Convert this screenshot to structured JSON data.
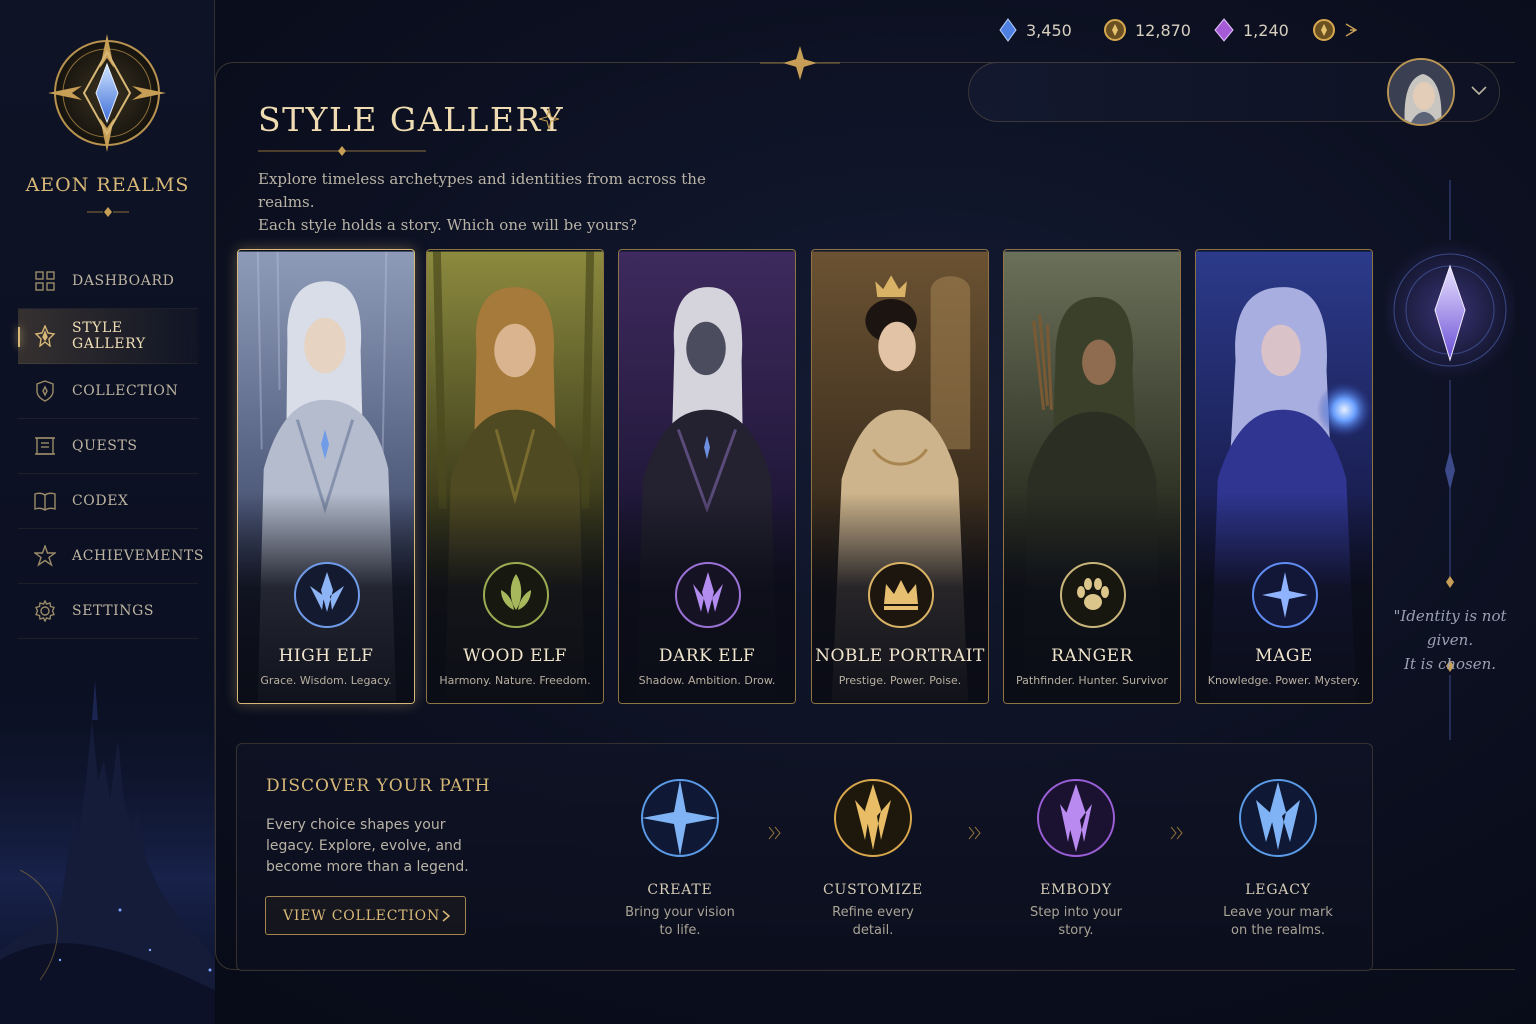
{
  "app": {
    "brand": "AEON REALMS"
  },
  "sidebar": {
    "items": [
      {
        "label": "DASHBOARD",
        "icon": "grid-icon",
        "active": false
      },
      {
        "label": "STYLE GALLERY",
        "icon": "flame-crest-icon",
        "active": true
      },
      {
        "label": "COLLECTION",
        "icon": "shield-icon",
        "active": false
      },
      {
        "label": "QUESTS",
        "icon": "scroll-icon",
        "active": false
      },
      {
        "label": "CODEX",
        "icon": "book-icon",
        "active": false
      },
      {
        "label": "ACHIEVEMENTS",
        "icon": "star-icon",
        "active": false
      },
      {
        "label": "SETTINGS",
        "icon": "gear-icon",
        "active": false
      }
    ]
  },
  "header": {
    "title": "STYLE GALLERY",
    "subtitle_line1": "Explore timeless archetypes and identities from across the realms.",
    "subtitle_line2": "Each style holds a story. Which one will be yours?"
  },
  "currencies": [
    {
      "value": "3,450",
      "icon": "blue-crystal-icon",
      "color": "#4f7fe0"
    },
    {
      "value": "12,870",
      "icon": "gold-coin-icon",
      "color": "#d6a84f"
    },
    {
      "value": "1,240",
      "icon": "purple-gem-icon",
      "color": "#a65bd6"
    }
  ],
  "styles": [
    {
      "name": "HIGH ELF",
      "tagline": "Grace. Wisdom. Legacy.",
      "accent": "#6f9be8",
      "selected": true
    },
    {
      "name": "WOOD ELF",
      "tagline": "Harmony. Nature. Freedom.",
      "accent": "#9cab52",
      "selected": false
    },
    {
      "name": "DARK ELF",
      "tagline": "Shadow. Ambition. Drow.",
      "accent": "#9a72d6",
      "selected": false
    },
    {
      "name": "NOBLE PORTRAIT",
      "tagline": "Prestige. Power. Poise.",
      "accent": "#d9b266",
      "selected": false
    },
    {
      "name": "RANGER",
      "tagline": "Pathfinder. Hunter. Survivor",
      "accent": "#c9b57a",
      "selected": false
    },
    {
      "name": "MAGE",
      "tagline": "Knowledge. Power. Mystery.",
      "accent": "#5f8cf0",
      "selected": false
    }
  ],
  "quote": {
    "line1": "\"Identity is not",
    "line2": "given.",
    "line3": "It is chosen."
  },
  "discover": {
    "title": "DISCOVER YOUR PATH",
    "text": "Every choice shapes your legacy. Explore, evolve, and become more than a legend.",
    "button": "VIEW COLLECTION",
    "steps": [
      {
        "name": "CREATE",
        "line1": "Bring your vision",
        "line2": "to life.",
        "color": "#5b9be8"
      },
      {
        "name": "CUSTOMIZE",
        "line1": "Refine every",
        "line2": "detail.",
        "color": "#d8a64c"
      },
      {
        "name": "EMBODY",
        "line1": "Step into your",
        "line2": "story.",
        "color": "#9a5fd6"
      },
      {
        "name": "LEGACY",
        "line1": "Leave your mark",
        "line2": "on the realms.",
        "color": "#5b9be8"
      }
    ]
  }
}
